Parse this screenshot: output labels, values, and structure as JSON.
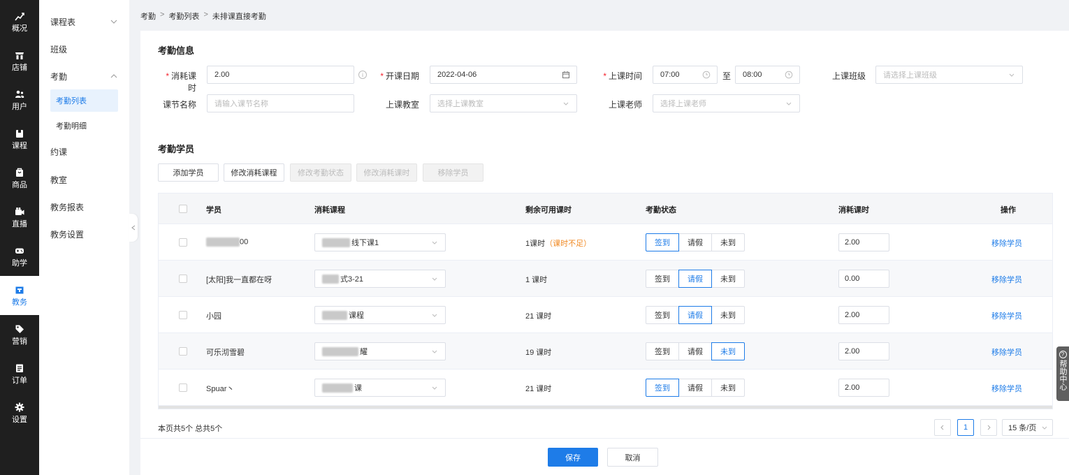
{
  "nav": [
    {
      "label": "概况",
      "icon": "chart-icon"
    },
    {
      "label": "店铺",
      "icon": "store-icon"
    },
    {
      "label": "用户",
      "icon": "users-icon"
    },
    {
      "label": "课程",
      "icon": "course-icon"
    },
    {
      "label": "商品",
      "icon": "goods-icon"
    },
    {
      "label": "直播",
      "icon": "live-icon"
    },
    {
      "label": "助学",
      "icon": "gamepad-icon"
    },
    {
      "label": "教务",
      "icon": "calendar-icon",
      "active": true
    },
    {
      "label": "营销",
      "icon": "tag-icon"
    },
    {
      "label": "订单",
      "icon": "order-icon"
    },
    {
      "label": "设置",
      "icon": "gear-icon"
    }
  ],
  "submenu": {
    "schedule": "课程表",
    "class": "班级",
    "attendance": "考勤",
    "attendance_list": "考勤列表",
    "attendance_detail": "考勤明细",
    "booking": "约课",
    "classroom": "教室",
    "report": "教务报表",
    "settings": "教务设置"
  },
  "breadcrumb": [
    "考勤",
    "考勤列表",
    "未排课直接考勤"
  ],
  "form": {
    "title": "考勤信息",
    "hours_label": "消耗课时",
    "hours_value": "2.00",
    "date_label": "开课日期",
    "date_value": "2022-04-06",
    "time_label": "上课时间",
    "time_start": "07:00",
    "time_to": "至",
    "time_end": "08:00",
    "class_label": "上课班级",
    "class_placeholder": "请选择上课班级",
    "section_label": "课节名称",
    "section_placeholder": "请输入课节名称",
    "room_label": "上课教室",
    "room_placeholder": "选择上课教室",
    "teacher_label": "上课老师",
    "teacher_placeholder": "选择上课老师"
  },
  "students": {
    "title": "考勤学员",
    "buttons": {
      "add": "添加学员",
      "change_course": "修改消耗课程",
      "change_status": "修改考勤状态",
      "change_hours": "修改消耗课时",
      "remove": "移除学员"
    },
    "columns": {
      "student": "学员",
      "course": "消耗课程",
      "remaining": "剩余可用课时",
      "status": "考勤状态",
      "hours": "消耗课时",
      "action": "操作"
    },
    "status_options": [
      "签到",
      "请假",
      "未到"
    ],
    "rows": [
      {
        "name": "00",
        "course": "线下课1",
        "remaining": "1课时",
        "warning": "（课时不足）",
        "status": "签到",
        "hours": "2.00",
        "action": "移除学员"
      },
      {
        "name": "[太阳]我一直都在呀",
        "course": "式3-21",
        "remaining": "1 课时",
        "warning": "",
        "status": "请假",
        "hours": "0.00",
        "action": "移除学员"
      },
      {
        "name": "小园",
        "course": "课程",
        "remaining": "21 课时",
        "warning": "",
        "status": "请假",
        "hours": "2.00",
        "action": "移除学员"
      },
      {
        "name": "可乐沏雪碧",
        "course": "耀",
        "remaining": "19 课时",
        "warning": "",
        "status": "未到",
        "hours": "2.00",
        "action": "移除学员"
      },
      {
        "name": "Spuar丶",
        "course": "课",
        "remaining": "21 课时",
        "warning": "",
        "status": "签到",
        "hours": "2.00",
        "action": "移除学员"
      }
    ]
  },
  "pagination": {
    "summary": "本页共5个 总共5个",
    "current": "1",
    "page_size": "15 条/页"
  },
  "footer": {
    "save": "保存",
    "cancel": "取消"
  },
  "help": {
    "label": "帮助中心"
  },
  "colors": {
    "accent": "#1e7ce8",
    "warning": "#f08a24",
    "nav_bg": "#1f1f1f"
  }
}
